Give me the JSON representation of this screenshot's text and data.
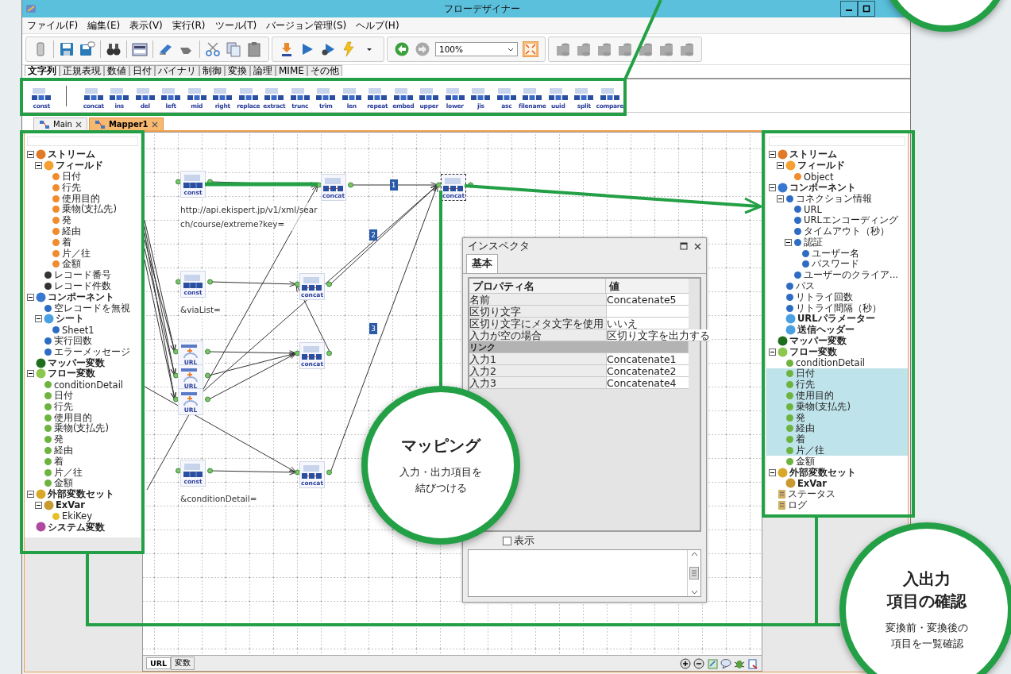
{
  "window": {
    "title": "フローデザイナー"
  },
  "menu": [
    "ファイル(F)",
    "編集(E)",
    "表示(V)",
    "実行(R)",
    "ツール(T)",
    "バージョン管理(S)",
    "ヘルプ(H)"
  ],
  "toolbar": {
    "zoom": "100%"
  },
  "palette_tabs": [
    {
      "label": "文字列",
      "selected": true
    },
    {
      "label": "正規表現",
      "selected": false
    },
    {
      "label": "数値",
      "selected": false
    },
    {
      "label": "日付",
      "selected": false
    },
    {
      "label": "バイナリ",
      "selected": false
    },
    {
      "label": "制御",
      "selected": false
    },
    {
      "label": "変換",
      "selected": false
    },
    {
      "label": "論理",
      "selected": false
    },
    {
      "label": "MIME",
      "selected": false
    },
    {
      "label": "その他",
      "selected": false
    }
  ],
  "palette": [
    "const",
    "concat",
    "ins",
    "del",
    "left",
    "mid",
    "right",
    "replace",
    "extract",
    "trunc",
    "trim",
    "len",
    "repeat",
    "embed",
    "upper",
    "lower",
    "jis",
    "asc",
    "filename",
    "uuid",
    "split",
    "compare"
  ],
  "document_tabs": [
    {
      "label": "Main",
      "selected": false
    },
    {
      "label": "Mapper1",
      "selected": true
    }
  ],
  "left_tree": [
    {
      "label": "ストリーム",
      "kind": "group",
      "color": "#e07a28",
      "children": [
        {
          "label": "フィールド",
          "kind": "group",
          "color": "#f5a030",
          "children": [
            {
              "label": "日付",
              "kind": "item",
              "color": "#f08c2e"
            },
            {
              "label": "行先",
              "kind": "item",
              "color": "#f08c2e"
            },
            {
              "label": "使用目的",
              "kind": "item",
              "color": "#f08c2e"
            },
            {
              "label": "乗物(支払先)",
              "kind": "item",
              "color": "#f08c2e"
            },
            {
              "label": "発",
              "kind": "item",
              "color": "#f08c2e"
            },
            {
              "label": "経由",
              "kind": "item",
              "color": "#f08c2e"
            },
            {
              "label": "着",
              "kind": "item",
              "color": "#f08c2e"
            },
            {
              "label": "片／往",
              "kind": "item",
              "color": "#f08c2e"
            },
            {
              "label": "金額",
              "kind": "item",
              "color": "#f08c2e"
            }
          ]
        },
        {
          "label": "レコード番号",
          "kind": "item",
          "color": "#333333"
        },
        {
          "label": "レコード件数",
          "kind": "item",
          "color": "#333333"
        }
      ]
    },
    {
      "label": "コンポーネント",
      "kind": "group",
      "color": "#3a78d0",
      "children": [
        {
          "label": "空レコードを無視",
          "kind": "item",
          "color": "#2e6cc4"
        },
        {
          "label": "シート",
          "kind": "group",
          "color": "#4aa0e0",
          "children": [
            {
              "label": "Sheet1",
              "kind": "item",
              "color": "#2e6cc4"
            }
          ]
        },
        {
          "label": "実行回数",
          "kind": "item",
          "color": "#2e6cc4"
        },
        {
          "label": "エラーメッセージ",
          "kind": "item",
          "color": "#2e6cc4"
        }
      ]
    },
    {
      "label": "マッパー変数",
      "kind": "group",
      "color": "#1d6e1d"
    },
    {
      "label": "フロー変数",
      "kind": "group",
      "color": "#8cc850",
      "children": [
        {
          "label": "conditionDetail",
          "kind": "item",
          "color": "#6db33f"
        },
        {
          "label": "日付",
          "kind": "item",
          "color": "#6db33f"
        },
        {
          "label": "行先",
          "kind": "item",
          "color": "#6db33f"
        },
        {
          "label": "使用目的",
          "kind": "item",
          "color": "#6db33f"
        },
        {
          "label": "乗物(支払先)",
          "kind": "item",
          "color": "#6db33f"
        },
        {
          "label": "発",
          "kind": "item",
          "color": "#6db33f"
        },
        {
          "label": "経由",
          "kind": "item",
          "color": "#6db33f"
        },
        {
          "label": "着",
          "kind": "item",
          "color": "#6db33f"
        },
        {
          "label": "片／往",
          "kind": "item",
          "color": "#6db33f"
        },
        {
          "label": "金額",
          "kind": "item",
          "color": "#6db33f"
        }
      ]
    },
    {
      "label": "外部変数セット",
      "kind": "group",
      "color": "#d8a828",
      "children": [
        {
          "label": "ExVar",
          "kind": "group",
          "color": "#c89a30",
          "children": [
            {
              "label": "EkiKey",
              "kind": "item",
              "color": "#e6c02a"
            }
          ]
        }
      ]
    },
    {
      "label": "システム変数",
      "kind": "group",
      "color": "#b04aa0"
    }
  ],
  "canvas": {
    "nodes": [
      {
        "kind": "const",
        "name": "const",
        "selected": false,
        "caption": "http://api.ekispert.jp/v1/xml/sear\nch/course/extreme?key="
      },
      {
        "kind": "concat",
        "name": "concat",
        "selected": false
      },
      {
        "kind": "concat",
        "name": "concat",
        "selected": true
      },
      {
        "kind": "const",
        "name": "const",
        "selected": false,
        "caption": "&viaList="
      },
      {
        "kind": "concat",
        "name": "concat",
        "selected": false
      },
      {
        "kind": "url",
        "name": "URL",
        "selected": false
      },
      {
        "kind": "url",
        "name": "URL",
        "selected": false
      },
      {
        "kind": "url",
        "name": "URL",
        "selected": false
      },
      {
        "kind": "concat",
        "name": "concat",
        "selected": false
      },
      {
        "kind": "const",
        "name": "const",
        "selected": false,
        "caption": "&conditionDetail="
      },
      {
        "kind": "concat",
        "name": "concat",
        "selected": false
      }
    ],
    "link_labels": [
      "1",
      "2",
      "3"
    ]
  },
  "inspector": {
    "title": "インスペクタ",
    "tabs": [
      {
        "label": "基本",
        "selected": true
      }
    ],
    "columns": [
      "プロパティ名",
      "値"
    ],
    "rows": [
      {
        "kind": "property",
        "name": "名前",
        "value": "Concatenate5"
      },
      {
        "kind": "property",
        "name": "区切り文字"
      },
      {
        "kind": "property",
        "name": "区切り文字にメタ文字を使用",
        "value": "いいえ"
      },
      {
        "kind": "property",
        "name": "入力が空の場合",
        "value": "区切り文字を出力する"
      },
      {
        "kind": "section",
        "name": "リンク"
      },
      {
        "kind": "property",
        "name": "入力1",
        "value": "Concatenate1"
      },
      {
        "kind": "property",
        "name": "入力2",
        "value": "Concatenate2"
      },
      {
        "kind": "property",
        "name": "入力3",
        "value": "Concatenate4"
      }
    ],
    "checkbox": {
      "label": "表示",
      "checked": false
    }
  },
  "right_tree": [
    {
      "label": "ストリーム",
      "kind": "group",
      "color": "#e07a28",
      "selected": false,
      "children": [
        {
          "label": "フィールド",
          "kind": "group",
          "color": "#f5a030",
          "selected": false,
          "children": [
            {
              "label": "Object",
              "kind": "item",
              "color": "#f08c2e",
              "selected": false
            }
          ]
        }
      ]
    },
    {
      "label": "コンポーネント",
      "kind": "group",
      "color": "#3a78d0",
      "selected": false,
      "children": [
        {
          "label": "コネクション情報",
          "kind": "item",
          "color": "#2e6cc4",
          "selected": false,
          "children": [
            {
              "label": "URL",
              "kind": "item",
              "color": "#2e6cc4",
              "selected": false
            },
            {
              "label": "URLエンコーディング",
              "kind": "item",
              "color": "#2e6cc4",
              "selected": false
            },
            {
              "label": "タイムアウト（秒）",
              "kind": "item",
              "color": "#2e6cc4",
              "selected": false
            },
            {
              "label": "認証",
              "kind": "item",
              "color": "#2e6cc4",
              "selected": false,
              "children": [
                {
                  "label": "ユーザー名",
                  "kind": "item",
                  "color": "#2e6cc4",
                  "selected": false
                },
                {
                  "label": "パスワード",
                  "kind": "item",
                  "color": "#2e6cc4",
                  "selected": false
                }
              ]
            },
            {
              "label": "ユーザーのクライア...",
              "kind": "item",
              "color": "#2e6cc4",
              "selected": false
            }
          ]
        },
        {
          "label": "パス",
          "kind": "item",
          "color": "#2e6cc4",
          "selected": false
        },
        {
          "label": "リトライ回数",
          "kind": "item",
          "color": "#2e6cc4",
          "selected": false
        },
        {
          "label": "リトライ間隔（秒）",
          "kind": "item",
          "color": "#2e6cc4",
          "selected": false
        },
        {
          "label": "URLパラメーター",
          "kind": "group",
          "color": "#4aa0e0",
          "selected": false
        },
        {
          "label": "送信ヘッダー",
          "kind": "group",
          "color": "#4aa0e0",
          "selected": false
        }
      ]
    },
    {
      "label": "マッパー変数",
      "kind": "group",
      "color": "#1d6e1d",
      "selected": false
    },
    {
      "label": "フロー変数",
      "kind": "group",
      "color": "#8cc850",
      "selected": false,
      "children": [
        {
          "label": "conditionDetail",
          "kind": "item",
          "color": "#6db33f",
          "selected": false
        },
        {
          "label": "日付",
          "kind": "item",
          "color": "#6db33f",
          "selected": true
        },
        {
          "label": "行先",
          "kind": "item",
          "color": "#6db33f",
          "selected": true
        },
        {
          "label": "使用目的",
          "kind": "item",
          "color": "#6db33f",
          "selected": true
        },
        {
          "label": "乗物(支払先)",
          "kind": "item",
          "color": "#6db33f",
          "selected": true
        },
        {
          "label": "発",
          "kind": "item",
          "color": "#6db33f",
          "selected": true
        },
        {
          "label": "経由",
          "kind": "item",
          "color": "#6db33f",
          "selected": true
        },
        {
          "label": "着",
          "kind": "item",
          "color": "#6db33f",
          "selected": true
        },
        {
          "label": "片／往",
          "kind": "item",
          "color": "#6db33f",
          "selected": true
        },
        {
          "label": "金額",
          "kind": "item",
          "color": "#6db33f",
          "selected": false
        }
      ]
    },
    {
      "label": "外部変数セット",
      "kind": "group",
      "color": "#d8a828",
      "selected": false,
      "children": [
        {
          "label": "ExVar",
          "kind": "group",
          "color": "#c89a30",
          "selected": false
        }
      ]
    },
    {
      "label": "ステータス",
      "kind": "doc",
      "color": "#d0b060",
      "selected": false
    },
    {
      "label": "ログ",
      "kind": "doc",
      "color": "#d0b060",
      "selected": false
    }
  ],
  "bottom_tabs": [
    {
      "label": "URL",
      "selected": true
    },
    {
      "label": "変数",
      "selected": false
    }
  ],
  "callouts": [
    {
      "title_lines": [
        "マッピング"
      ],
      "text_lines": [
        "入力・出力項目を",
        "結びつける"
      ]
    },
    {
      "title_lines": [
        "入出力",
        "項目の確認"
      ],
      "text_lines": [
        "変換前・変換後の",
        "項目を一覧確認"
      ]
    }
  ]
}
